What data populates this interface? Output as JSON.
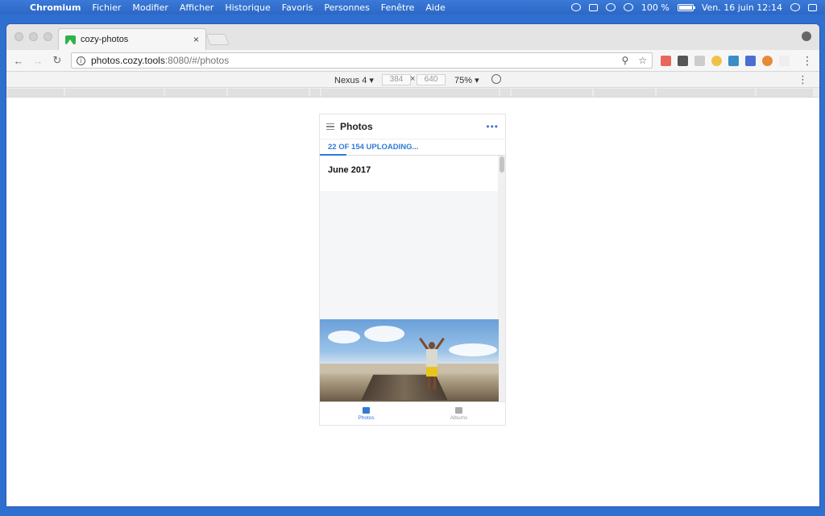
{
  "menubar": {
    "app_name": "Chromium",
    "items": [
      "Fichier",
      "Modifier",
      "Afficher",
      "Historique",
      "Favoris",
      "Personnes",
      "Fenêtre",
      "Aide"
    ],
    "battery": "100 %",
    "clock": "Ven. 16 juin  12:14"
  },
  "browser": {
    "tab_title": "cozy-photos",
    "tab_close": "×",
    "url_host": "photos.cozy.tools",
    "url_rest": ":8080/#/photos"
  },
  "devtools": {
    "device": "Nexus 4",
    "width": "384",
    "height": "640",
    "times": "×",
    "zoom": "75%"
  },
  "app": {
    "title": "Photos",
    "more": "•••",
    "upload_status": "22 OF 154 UPLOADING...",
    "upload_progress": 0.143,
    "section_title": "June 2017",
    "nav": {
      "photos_label": "Photos",
      "albums_label": "Albums"
    }
  },
  "colors": {
    "accent": "#2f7bd6",
    "desktop": "#2f6fd0"
  }
}
